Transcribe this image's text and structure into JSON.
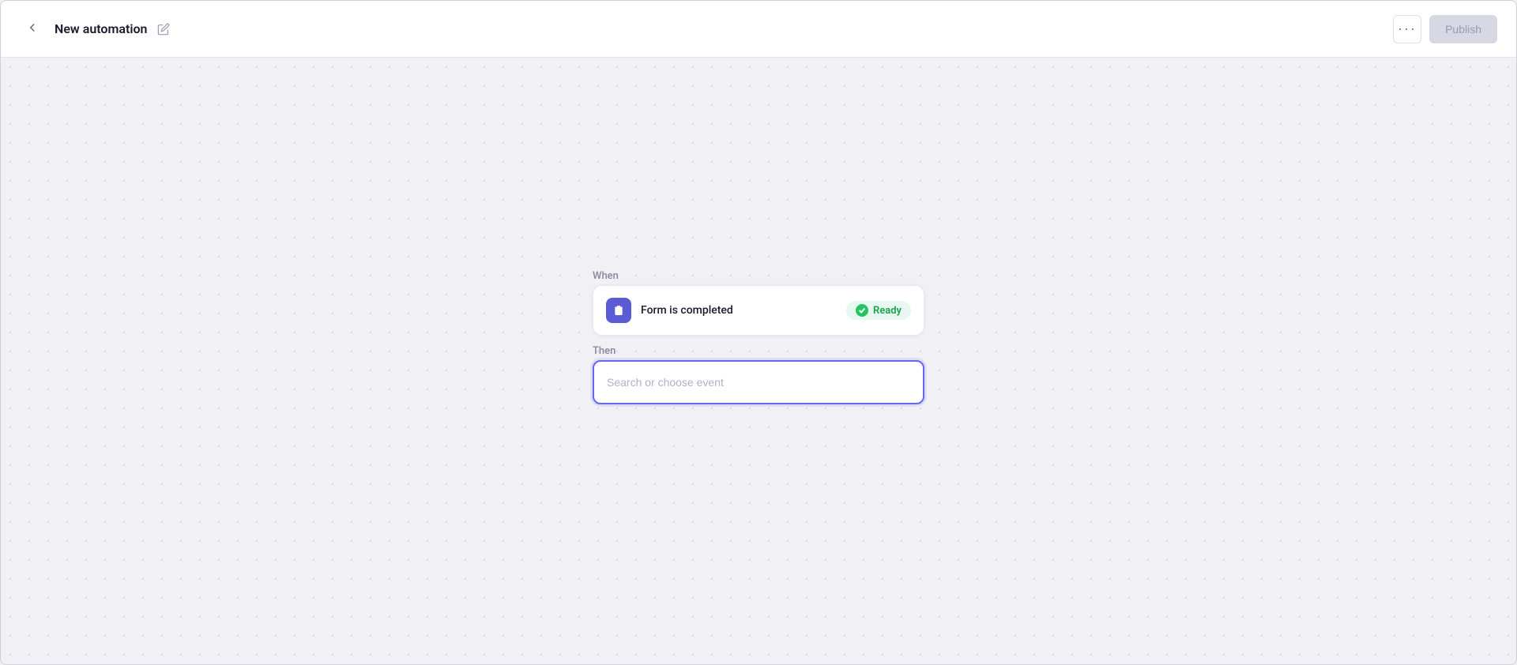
{
  "header": {
    "title": "New automation",
    "back_label": "back",
    "more_label": "···",
    "publish_label": "Publish"
  },
  "workflow": {
    "when_label": "When",
    "then_label": "Then",
    "trigger": {
      "label": "Form is completed",
      "status": "Ready"
    },
    "action": {
      "placeholder": "Search or choose event"
    }
  }
}
